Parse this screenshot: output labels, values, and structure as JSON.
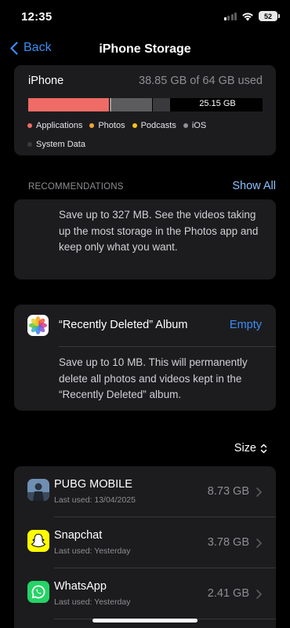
{
  "status": {
    "time": "12:35",
    "battery": "52"
  },
  "nav": {
    "back_label": "Back",
    "title": "iPhone Storage"
  },
  "storage": {
    "device": "iPhone",
    "used_text": "38.85 GB of 64 GB used",
    "free_text": "25.15 GB",
    "segments": [
      {
        "name": "Applications",
        "color": "#ef6b66"
      },
      {
        "name": "iOS",
        "color": "#5c5c5e"
      },
      {
        "name": "System Data",
        "color": "#3a3a3c"
      }
    ],
    "legend": [
      {
        "label": "Applications",
        "color": "#ef6b66"
      },
      {
        "label": "Photos",
        "color": "#f2a33a"
      },
      {
        "label": "Podcasts",
        "color": "#f5c518"
      },
      {
        "label": "iOS",
        "color": "#8e8e93"
      },
      {
        "label": "System Data",
        "color": "#3a3a3c"
      }
    ]
  },
  "recommendations": {
    "header": "RECOMMENDATIONS",
    "show_all": "Show All",
    "review_videos_text": "Save up to 327 MB. See the videos taking up the most storage in the Photos app and keep only what you want.",
    "recently_deleted": {
      "title": "“Recently Deleted” Album",
      "action": "Empty",
      "text": "Save up to 10 MB. This will permanently delete all photos and videos kept in the “Recently Deleted” album."
    }
  },
  "sort": {
    "label": "Size"
  },
  "apps": [
    {
      "name": "PUBG MOBILE",
      "last_used": "Last used: 13/04/2025",
      "size": "8.73 GB",
      "icon": "pubg-icon"
    },
    {
      "name": "Snapchat",
      "last_used": "Last used: Yesterday",
      "size": "3.78 GB",
      "icon": "snapchat-icon"
    },
    {
      "name": "WhatsApp",
      "last_used": "Last used: Yesterday",
      "size": "2.41 GB",
      "icon": "whatsapp-icon"
    }
  ],
  "colors": {
    "accent": "#3a8ef6",
    "card": "#1c1c1e",
    "secondary_text": "#8e8e93"
  }
}
